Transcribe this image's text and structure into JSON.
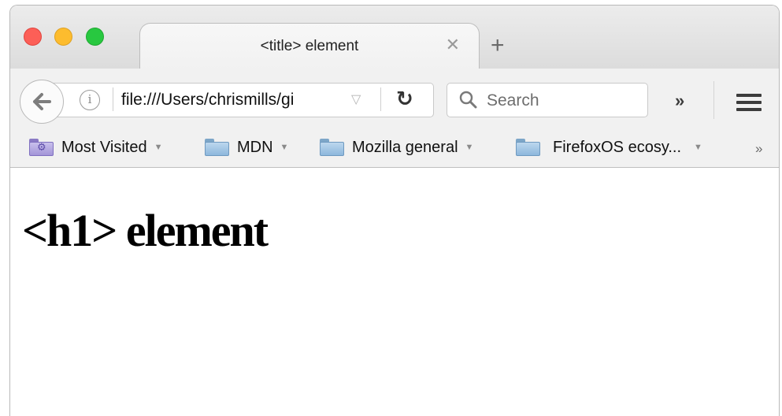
{
  "tab": {
    "title": "<title> element",
    "close_glyph": "✕",
    "new_tab_glyph": "+"
  },
  "navbar": {
    "url": "file:///Users/chrismills/gi",
    "info_glyph": "i",
    "dropdown_glyph": "▽",
    "reload_glyph": "↻",
    "search_placeholder": "Search",
    "overflow_glyph": "»"
  },
  "bookmarks": {
    "items": [
      {
        "label": "Most Visited",
        "icon": "most-visited-folder-icon"
      },
      {
        "label": "MDN",
        "icon": "folder-icon"
      },
      {
        "label": "Mozilla general",
        "icon": "folder-icon"
      },
      {
        "label": "FirefoxOS ecosy...",
        "icon": "folder-icon"
      }
    ],
    "caret_glyph": "▼",
    "overflow_glyph": "»"
  },
  "content": {
    "heading": "<h1> element"
  },
  "colors": {
    "close": "#fc5f57",
    "minimize": "#fdbc2e",
    "zoom": "#28c840"
  }
}
